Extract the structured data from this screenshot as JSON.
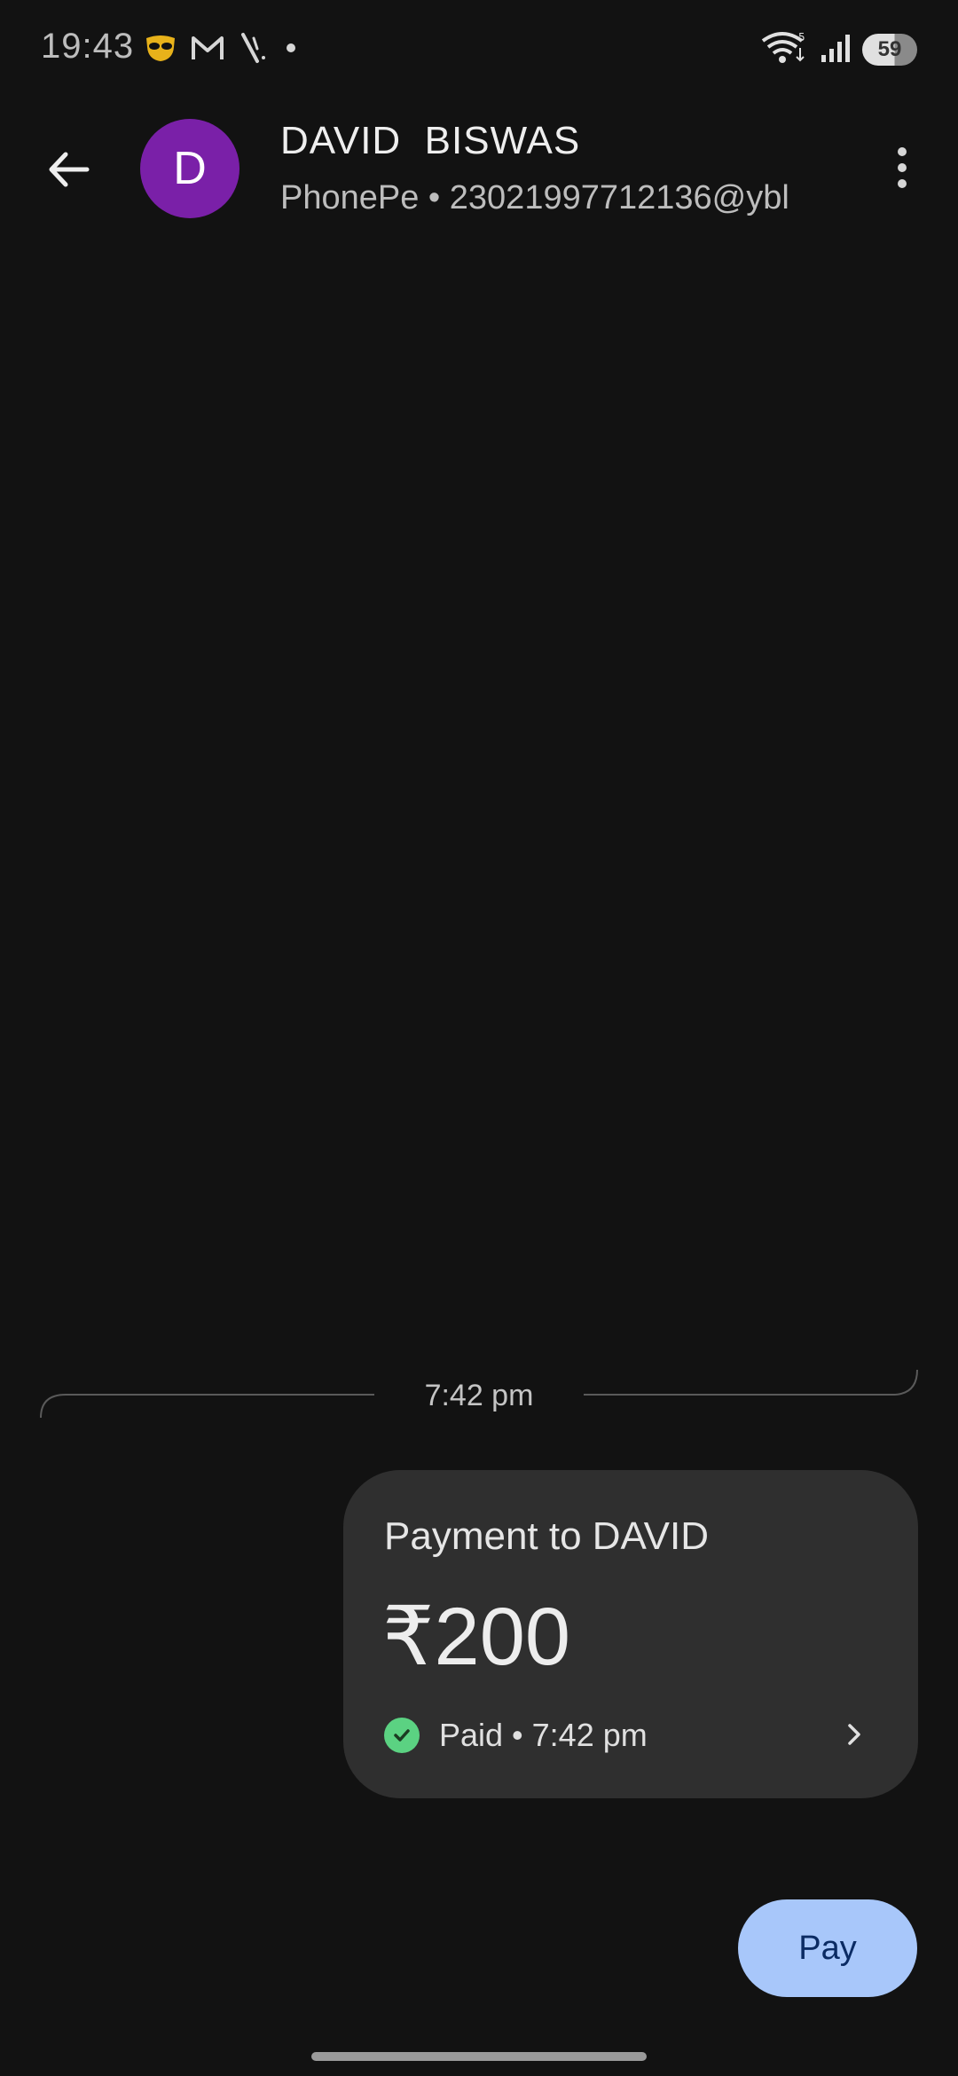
{
  "status_bar": {
    "time": "19:43",
    "battery_level": "59",
    "icons": [
      "grindr-icon",
      "gmail-icon",
      "feather-icon",
      "notification-dot-icon",
      "wifi-icon",
      "signal-icon",
      "battery-icon"
    ]
  },
  "header": {
    "avatar_initial": "D",
    "contact_name": "DAVID  BISWAS",
    "contact_sub": "PhonePe • 23021997712136@ybl",
    "avatar_color": "#7a20a8"
  },
  "chat": {
    "divider_time": "7:42 pm",
    "payment": {
      "title": "Payment to DAVID",
      "amount": "₹200",
      "status": "Paid • 7:42 pm",
      "status_color": "#5bd282"
    }
  },
  "actions": {
    "pay_label": "Pay",
    "pay_color": "#a8c7fa"
  }
}
